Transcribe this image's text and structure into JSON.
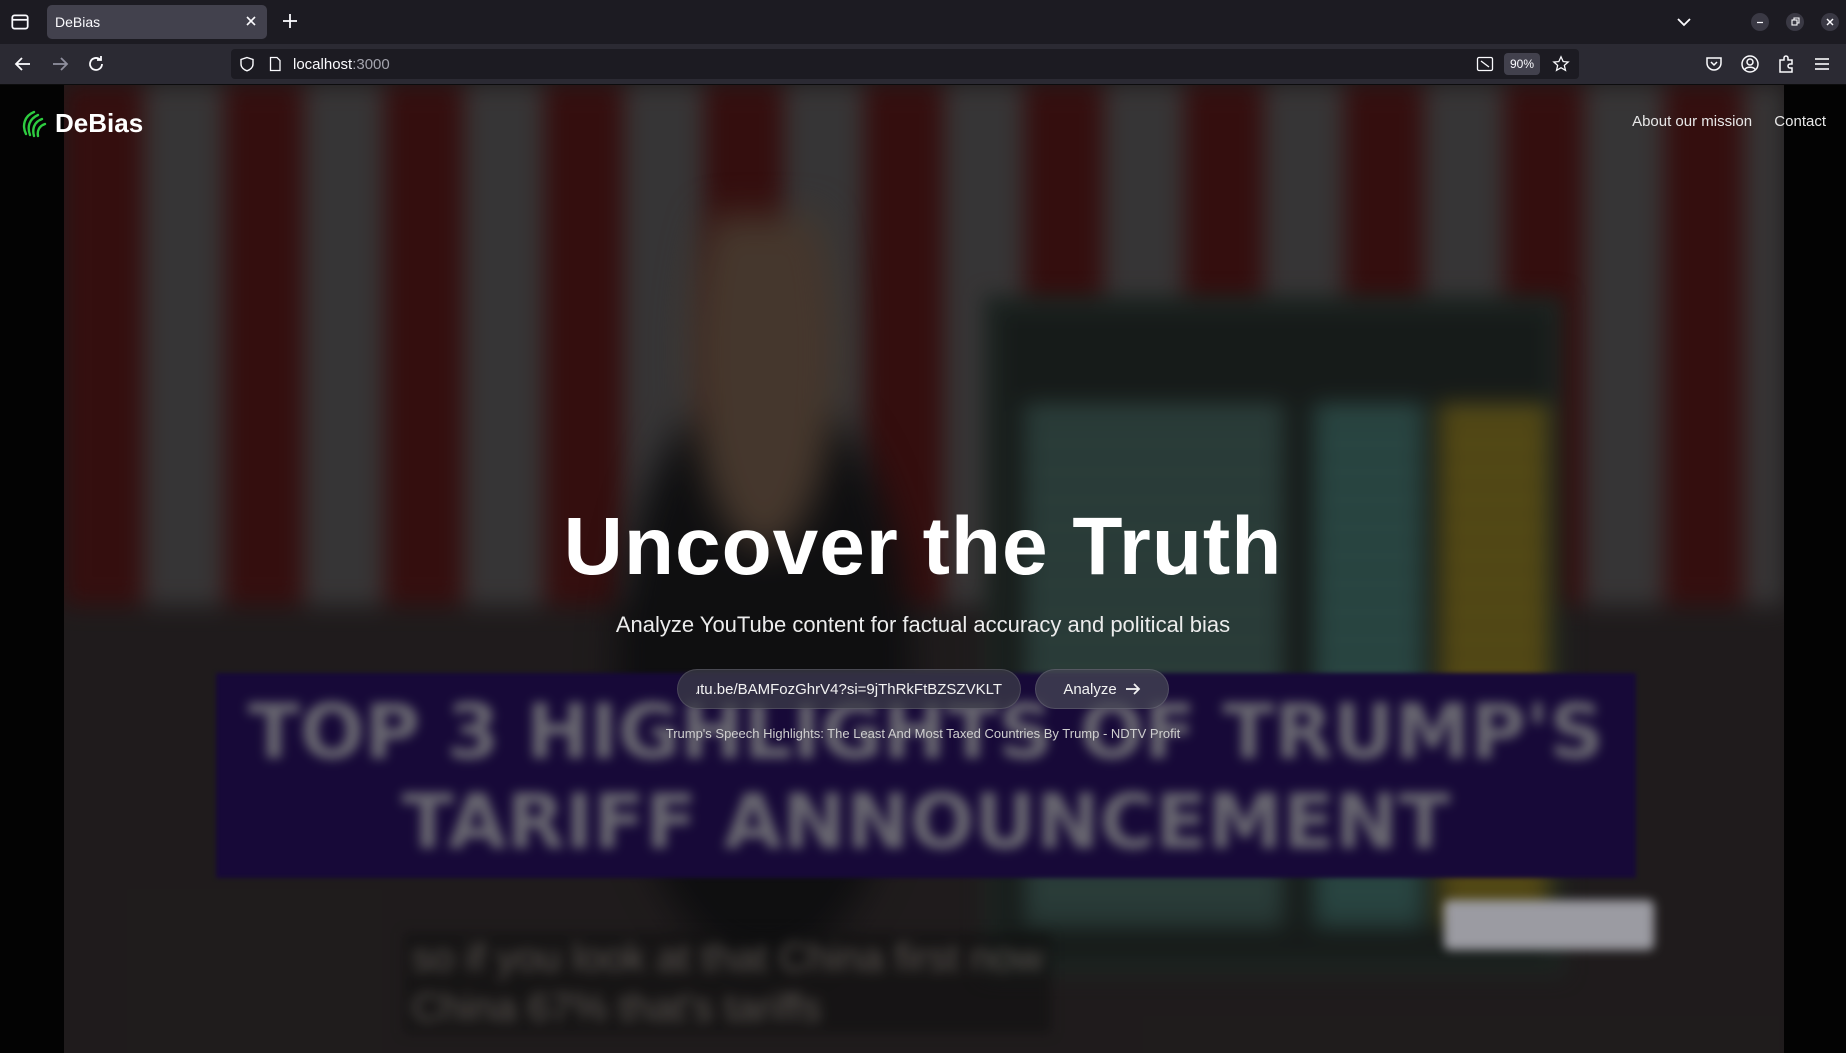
{
  "browser": {
    "tab_title": "DeBias",
    "url_host": "localhost",
    "url_port": ":3000",
    "zoom": "90%"
  },
  "site": {
    "brand": "DeBias",
    "brand_color": "#2ecc40",
    "nav": [
      "About our mission",
      "Contact"
    ]
  },
  "hero": {
    "title": "Uncover the Truth",
    "subtitle": "Analyze YouTube content for factual accuracy and political bias",
    "input_value": "https://youtu.be/BAMFozGhrV4?si=9jThRkFtBZSZVKLT",
    "button_label": "Analyze",
    "video_title": "Trump's Speech Highlights: The Least And Most Taxed Countries By Trump - NDTV Profit"
  },
  "background_thumbnail": {
    "banner_line1": "TOP 3 HIGHLIGHTS OF TRUMP'S",
    "banner_line2": "TARIFF ANNOUNCEMENT",
    "caption_line1": "so if you look at that China first now",
    "caption_line2": "China 67% that's tariffs"
  }
}
